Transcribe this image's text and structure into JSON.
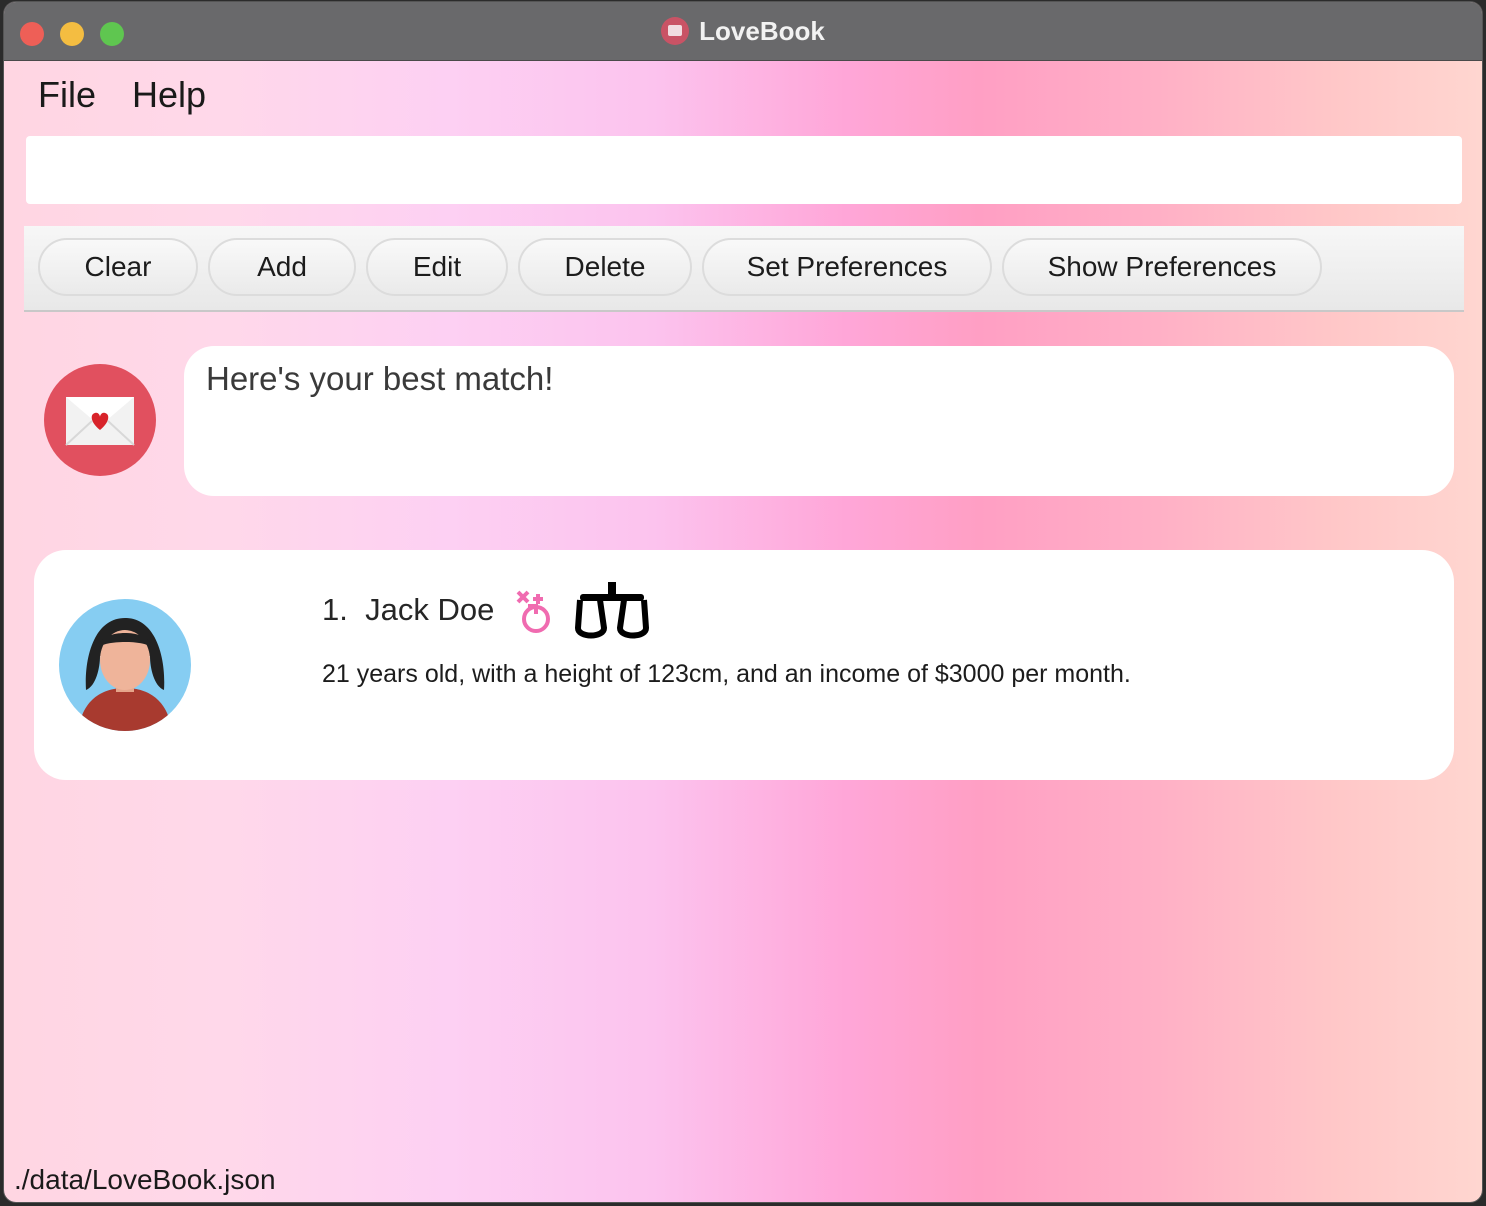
{
  "window": {
    "title": "LoveBook"
  },
  "menu": {
    "items": [
      "File",
      "Help"
    ]
  },
  "command_box": {
    "value": "",
    "placeholder": ""
  },
  "toolbar": {
    "buttons": [
      "Clear",
      "Add",
      "Edit",
      "Delete",
      "Set Preferences",
      "Show Preferences"
    ]
  },
  "result_display": {
    "message": "Here's your best match!"
  },
  "person_list": {
    "items": [
      {
        "index": "1.",
        "name": "Jack Doe",
        "description": "21 years old, with a height of 123cm, and an income of $3000 per month.",
        "gender_icon": "female-male-symbol-icon",
        "zodiac_icon": "libra-icon"
      }
    ]
  },
  "status_bar": {
    "path": "./data/LoveBook.json"
  },
  "colors": {
    "bot_avatar": "#e1505f",
    "titlebar": "#69696b",
    "gender_icon": "#f06bb0"
  }
}
